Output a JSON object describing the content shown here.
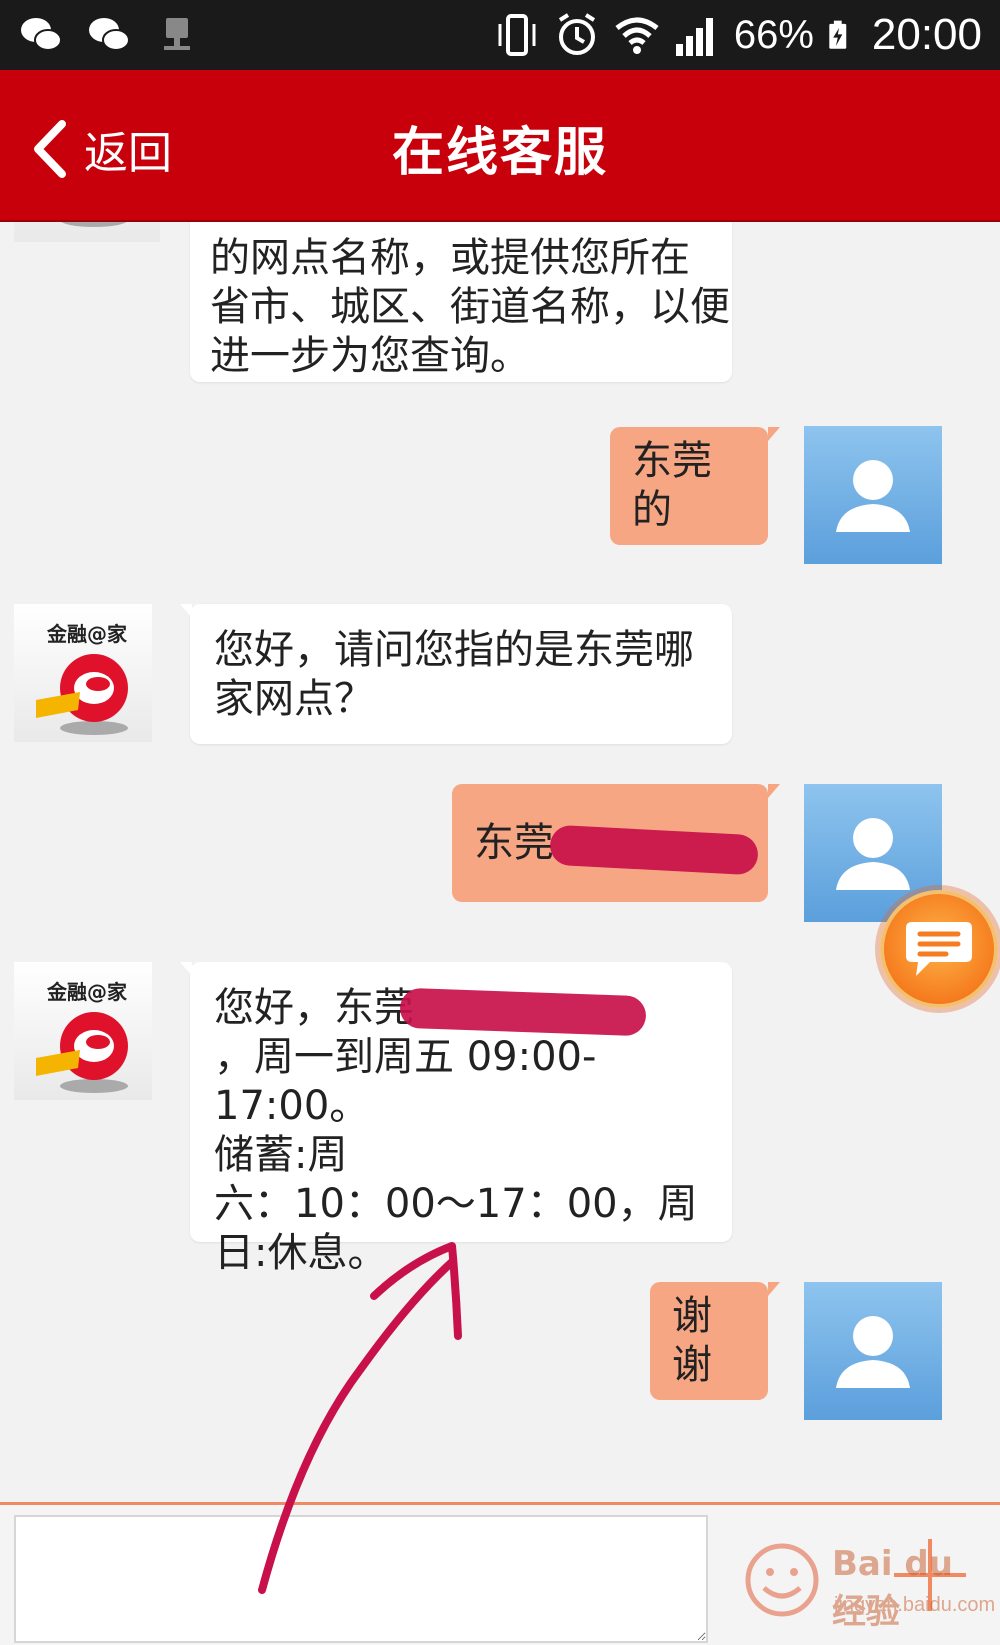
{
  "status_bar": {
    "battery": "66%",
    "time": "20:00",
    "icons": [
      "wechat-icon",
      "wechat-icon",
      "network-icon",
      "vibrate-icon",
      "alarm-icon",
      "wifi-icon",
      "signal-icon",
      "battery-charging-icon"
    ]
  },
  "header": {
    "back_label": "返回",
    "title": "在线客服"
  },
  "avatars": {
    "bank_brand": "金融@家"
  },
  "messages": [
    {
      "from": "agent",
      "lines": [
        "的网点名称，或提供您所在",
        "省市、城区、街道名称，以便",
        "进一步为您查询。"
      ]
    },
    {
      "from": "user",
      "text": "东莞的"
    },
    {
      "from": "agent",
      "lines": [
        "您好，请问您指的是东莞哪",
        "家网点？"
      ]
    },
    {
      "from": "user",
      "text": "东莞"
    },
    {
      "from": "agent",
      "lines": [
        "您好，东莞",
        "，周一到周五 09:00-17:00。",
        "储蓄:周",
        "六：10：00～17：00，周",
        "日:休息。"
      ]
    },
    {
      "from": "user",
      "text": "谢谢"
    }
  ],
  "input": {
    "placeholder": ""
  },
  "watermark": {
    "text": "Bai du 经验",
    "sub": "jingyan.baidu.com"
  },
  "colors": {
    "header_red": "#c8000b",
    "user_bubble": "#f7a684",
    "agent_bubble": "#ffffff",
    "annotation": "#c8104a"
  }
}
